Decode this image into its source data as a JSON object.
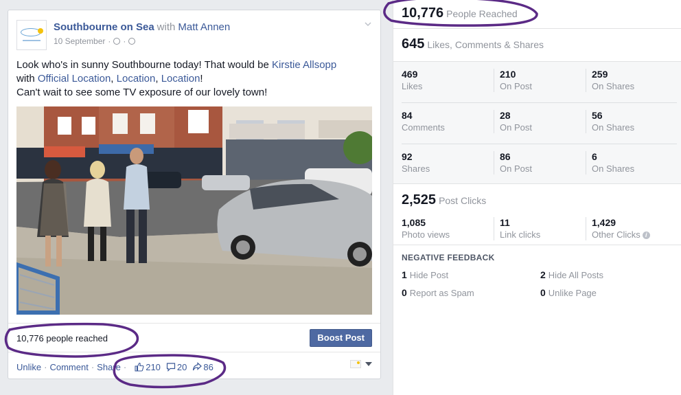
{
  "post": {
    "page_name": "Southbourne on Sea",
    "with_word": "with",
    "with_name": "Matt Annen",
    "date": "10 September",
    "meta_sep": "·",
    "text": {
      "line1": "Look who's in sunny Southbourne today! That would be ",
      "mention1": "Kirstie Allsopp",
      "line2_prefix": "with ",
      "tag1": "Official Location",
      "comma1": ", ",
      "tag2": "Location",
      "comma2": ", ",
      "tag3": "Location",
      "excl": "!",
      "line3": "Can't wait to see some TV exposure of our lovely town!"
    },
    "reach_text": "10,776 people reached",
    "boost_label": "Boost Post",
    "actions": {
      "unlike": "Unlike",
      "comment": "Comment",
      "share": "Share",
      "sep": "·",
      "likes": "210",
      "comments": "20",
      "shares": "86"
    }
  },
  "insights": {
    "reached": {
      "value": "10,776",
      "label": "People Reached"
    },
    "engagement": {
      "value": "645",
      "label": "Likes, Comments & Shares"
    },
    "rows": [
      {
        "cells": [
          {
            "value": "469",
            "label": "Likes"
          },
          {
            "value": "210",
            "label": "On Post"
          },
          {
            "value": "259",
            "label": "On Shares"
          }
        ]
      },
      {
        "cells": [
          {
            "value": "84",
            "label": "Comments"
          },
          {
            "value": "28",
            "label": "On Post"
          },
          {
            "value": "56",
            "label": "On Shares"
          }
        ]
      },
      {
        "cells": [
          {
            "value": "92",
            "label": "Shares"
          },
          {
            "value": "86",
            "label": "On Post"
          },
          {
            "value": "6",
            "label": "On Shares"
          }
        ]
      }
    ],
    "post_clicks": {
      "value": "2,525",
      "label": "Post Clicks"
    },
    "clicks": [
      {
        "value": "1,085",
        "label": "Photo views"
      },
      {
        "value": "11",
        "label": "Link clicks"
      },
      {
        "value": "1,429",
        "label": "Other Clicks"
      }
    ],
    "negative": {
      "title": "NEGATIVE FEEDBACK",
      "items": [
        {
          "value": "1",
          "label": "Hide Post"
        },
        {
          "value": "2",
          "label": "Hide All Posts"
        },
        {
          "value": "0",
          "label": "Report as Spam"
        },
        {
          "value": "0",
          "label": "Unlike Page"
        }
      ]
    }
  },
  "colors": {
    "link": "#3b5998",
    "boost": "#4e69a2",
    "annotation": "#5b2a86"
  }
}
